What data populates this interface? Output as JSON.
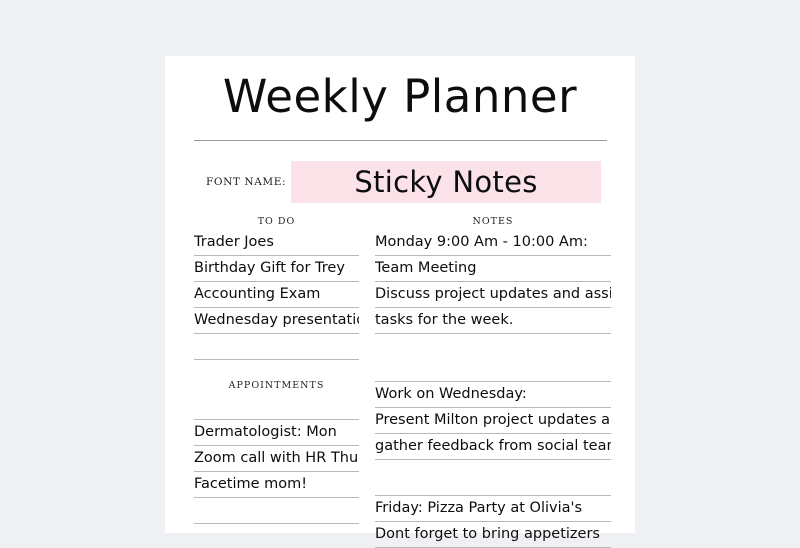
{
  "background_color": "#eef0f3",
  "page_color": "#ffffff",
  "header": {
    "title": "Weekly Planner"
  },
  "font_name_row": {
    "label": "FONT NAME:",
    "value": "Sticky Notes",
    "highlight_color": "#fbe2e8"
  },
  "left_column": {
    "todo": {
      "heading": "TO DO",
      "items": [
        "Trader Joes",
        "Birthday Gift for Trey",
        "Accounting Exam",
        "Wednesday presentation",
        ""
      ]
    },
    "appointments": {
      "heading": "APPOINTMENTS",
      "items": [
        "Dermatologist: Mon",
        "Zoom call with HR Thu.",
        "Facetime mom!",
        ""
      ]
    }
  },
  "right_column": {
    "notes": {
      "heading": "NOTES",
      "block1": [
        "Monday 9:00 Am - 10:00 Am:",
        "Team Meeting",
        "Discuss project updates and assign",
        "tasks for the week."
      ],
      "block2": [
        "Work on Wednesday:",
        "Present Milton project updates and",
        "gather feedback from social team."
      ],
      "block3": [
        "Friday: Pizza Party at Olivia's",
        "Dont forget to bring appetizers"
      ]
    }
  }
}
